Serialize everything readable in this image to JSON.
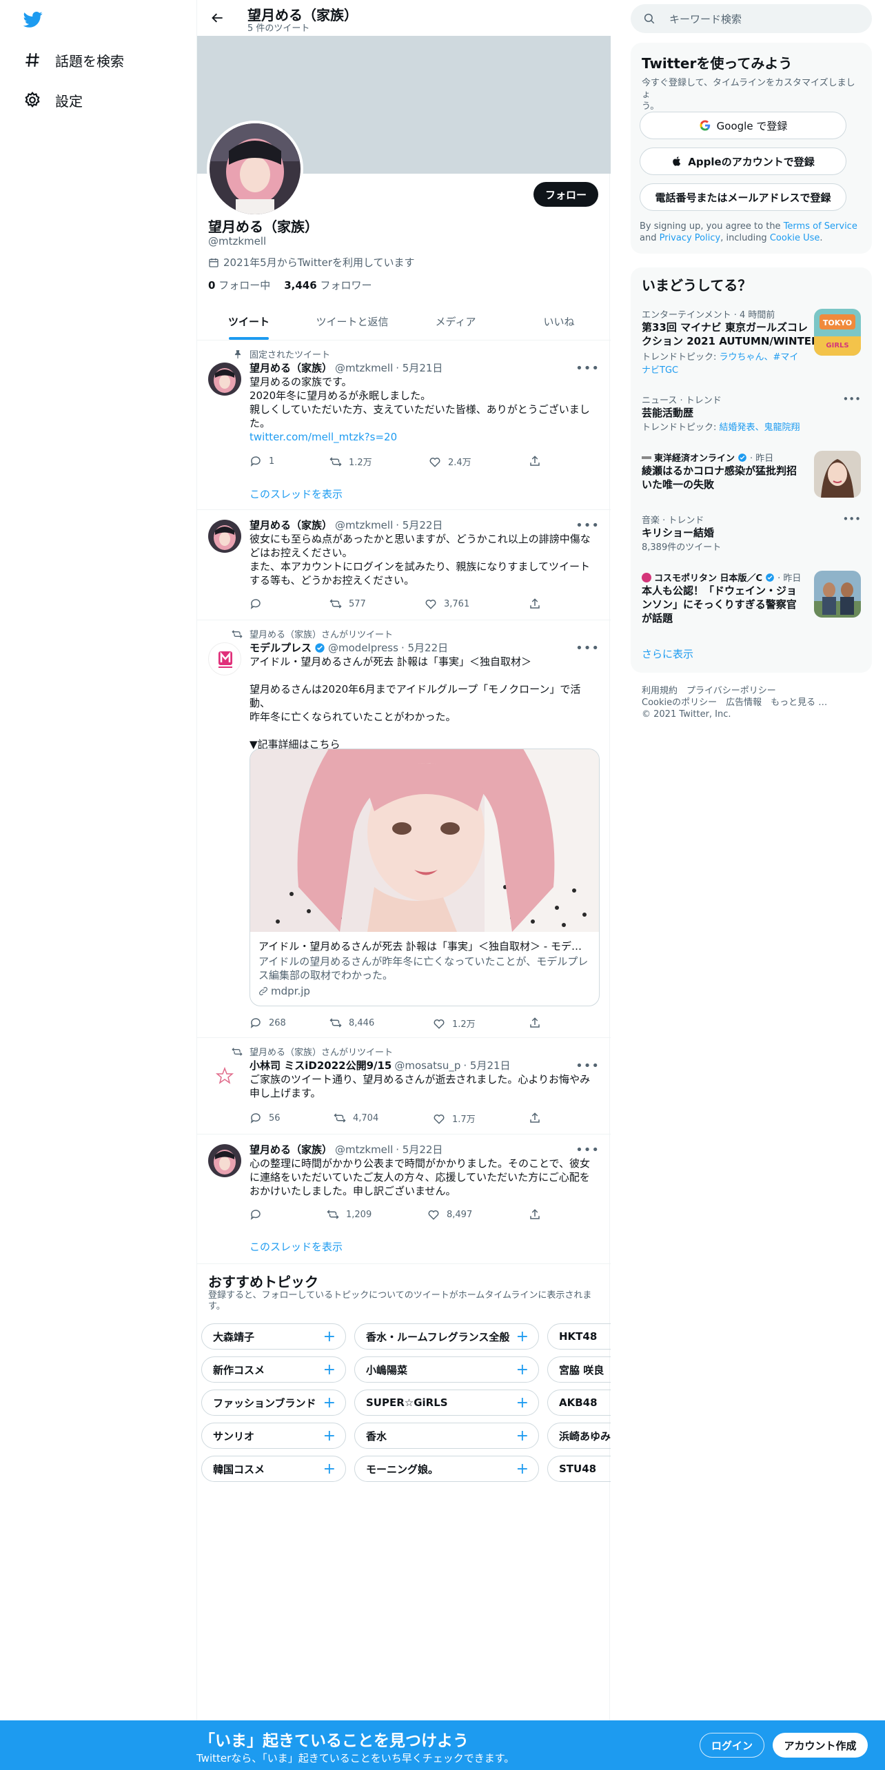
{
  "nav": {
    "explore_label": "話題を検索",
    "settings_label": "設定"
  },
  "profile": {
    "name": "望月める（家族）",
    "tweet_count": "5 件のツイート",
    "handle": "@mtzkmell",
    "joined": "2021年5月からTwitterを利用しています",
    "following_num": "0",
    "following_label": "フォロー中",
    "followers_num": "3,446",
    "followers_label": "フォロワー",
    "follow_button": "フォロー"
  },
  "tabs": [
    "ツイート",
    "ツイートと返信",
    "メディア",
    "いいね"
  ],
  "tweets": {
    "t1": {
      "context": "固定されたツイート",
      "name": "望月める（家族）",
      "handle": "@mtzkmell",
      "date": "· 5月21日",
      "lines": [
        "望月めるの家族です。",
        "2020年冬に望月めるが永眠しました。",
        "親しくしていただいた方、支えていただいた皆様、ありがとうございまし",
        "た。"
      ],
      "link": "twitter.com/mell_mtzk?s=20",
      "replies": "1",
      "retweets": "1.2万",
      "likes": "2.4万",
      "show_thread": "このスレッドを表示"
    },
    "t2": {
      "name": "望月める（家族）",
      "handle": "@mtzkmell",
      "date": "· 5月22日",
      "lines": [
        "彼女にも至らぬ点があったかと思いますが、どうかこれ以上の誹謗中傷な",
        "どはお控えください。",
        "また、本アカウントにログインを試みたり、親族になりすましてツイート",
        "する等も、どうかお控えください。"
      ],
      "replies": "",
      "retweets": "577",
      "likes": "3,761"
    },
    "t3": {
      "context": "望月める（家族）さんがリツイート",
      "name": "モデルプレス",
      "handle": "@modelpress",
      "date": "· 5月22日",
      "line1": "アイドル・望月めるさんが死去 訃報は「事実」＜独自取材＞",
      "line2": "望月めるさんは2020年6月までアイドルグループ「モノクローン」で活動、",
      "line3": "昨年冬に亡くなられていたことがわかった。",
      "line4": "▼記事詳細はこちら",
      "card_title": "アイドル・望月めるさんが死去 訃報は「事実」＜独自取材＞ - モデ…",
      "card_desc1": "アイドルの望月めるさんが昨年冬に亡くなっていたことが、モデルプレ",
      "card_desc2": "ス編集部の取材でわかった。",
      "card_domain": "mdpr.jp",
      "replies": "268",
      "retweets": "8,446",
      "likes": "1.2万"
    },
    "t4": {
      "context": "望月める（家族）さんがリツイート",
      "name": "小林司 ミスiD2022公開9/15",
      "handle": "@mosatsu_p",
      "date": "· 5月21日",
      "line1": "ご家族のツイート通り、望月めるさんが逝去されました。心よりお悔やみ",
      "line2": "申し上げます。",
      "replies": "56",
      "retweets": "4,704",
      "likes": "1.7万"
    },
    "t5": {
      "name": "望月める（家族）",
      "handle": "@mtzkmell",
      "date": "· 5月22日",
      "line1": "心の整理に時間がかかり公表まで時間がかかりました。そのことで、彼女",
      "line2": "に連絡をいただいていたご友人の方々、応援していただいた方にご心配を",
      "line3": "おかけいたしました。申し訳ございません。",
      "replies": "",
      "retweets": "1,209",
      "likes": "8,497",
      "show_thread": "このスレッドを表示"
    }
  },
  "topics": {
    "title": "おすすめトピック",
    "desc1": "登録すると、フォローしているトピックについてのツイートがホームタイムラインに表示されま",
    "desc2": "す。",
    "col1": [
      "大森靖子",
      "新作コスメ",
      "ファッションブランド",
      "サンリオ",
      "韓国コスメ"
    ],
    "col2": [
      "香水・ルームフレグランス全般",
      "小嶋陽菜",
      "SUPER☆GiRLS",
      "香水",
      "モーニング娘。"
    ],
    "col3": [
      "HKT48",
      "宮脇 咲良",
      "AKB48",
      "浜崎あゆみ",
      "STU48"
    ]
  },
  "right": {
    "search_placeholder": "キーワード検索",
    "signup_title": "Twitterを使ってみよう",
    "signup_desc1": "今すぐ登録して、タイムラインをカスタマイズしましょ",
    "signup_desc2": "う。",
    "google_btn": "Google で登録",
    "apple_btn": "Appleのアカウントで登録",
    "phone_btn": "電話番号またはメールアドレスで登録",
    "terms1": "By signing up, you agree to the",
    "terms_link1": "Terms of Service",
    "terms_and": "and",
    "terms_link2": "Privacy Policy",
    "terms_including": ", including",
    "terms_link3": "Cookie Use",
    "terms_end": ".",
    "trends_title": "いまどうしてる？",
    "trends": [
      {
        "cat": "エンターテインメント · 4 時間前",
        "t1": "第33回 マイナビ 東京ガールズコレ",
        "t2": "クション 2021 AUTUMN/WINTER",
        "sub_prefix": "トレンドトピック: ",
        "sub_link1": "ラウちゃん、#マイ",
        "sub_link2": "ナビTGC"
      },
      {
        "cat": "ニュース · トレンド",
        "t1": "芸能活動歴",
        "sub_prefix": "トレンドトピック: ",
        "sub_link1": "結婚発表、鬼龍院翔"
      },
      {
        "source": "東洋経済オンライン",
        "time": "· 昨日",
        "t1": "綾瀬はるかコロナ感染が猛批判招",
        "t2": "いた唯一の失敗"
      },
      {
        "cat": "音楽 · トレンド",
        "t1": "キリショー結婚",
        "count": "8,389件のツイート"
      },
      {
        "source": "コスモポリタン 日本版／C",
        "time": "· 昨日",
        "t1": "本人も公認！「ドウェイン・ジョ",
        "t2": "ンソン」にそっくりすぎる警察官",
        "t3": "が話題"
      }
    ],
    "show_more": "さらに表示",
    "footer1": "利用規約　プライバシーポリシー",
    "footer2": "Cookieのポリシー　広告情報　もっと見る …",
    "footer3": "© 2021 Twitter, Inc."
  },
  "bottom": {
    "title": "「いま」起きていることを見つけよう",
    "subtitle": "Twitterなら、「いま」起きていることをいち早くチェックできます。",
    "login": "ログイン",
    "signup": "アカウント作成"
  },
  "colors": {
    "accent": "#1d9bf0",
    "text": "#0f1419",
    "muted": "#536471",
    "banner": "#cfd9de"
  }
}
